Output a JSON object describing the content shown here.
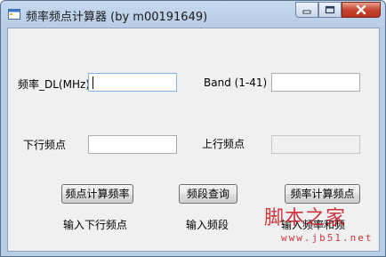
{
  "window": {
    "title": "频率频点计算器 (by m00191649)"
  },
  "controls": {
    "minimize": "minimize",
    "maximize": "maximize",
    "close": "close"
  },
  "form": {
    "freq_dl_label": "频率_DL(MHz)",
    "freq_dl_value": "",
    "band_label": "Band (1-41)",
    "band_value": "",
    "dl_channel_label": "下行频点",
    "dl_channel_value": "",
    "ul_channel_label": "上行频点",
    "ul_channel_value": ""
  },
  "buttons": {
    "channel_to_freq": "频点计算频率",
    "band_query": "频段查询",
    "freq_to_channel": "频率计算频点"
  },
  "hints": {
    "channel_to_freq": "输入下行频点",
    "band_query": "输入频段",
    "freq_to_channel": "输入频率和频"
  },
  "watermark": {
    "text": "脚本之家",
    "url": "www.jb51.net"
  },
  "colors": {
    "accent_red": "#c9151e"
  }
}
